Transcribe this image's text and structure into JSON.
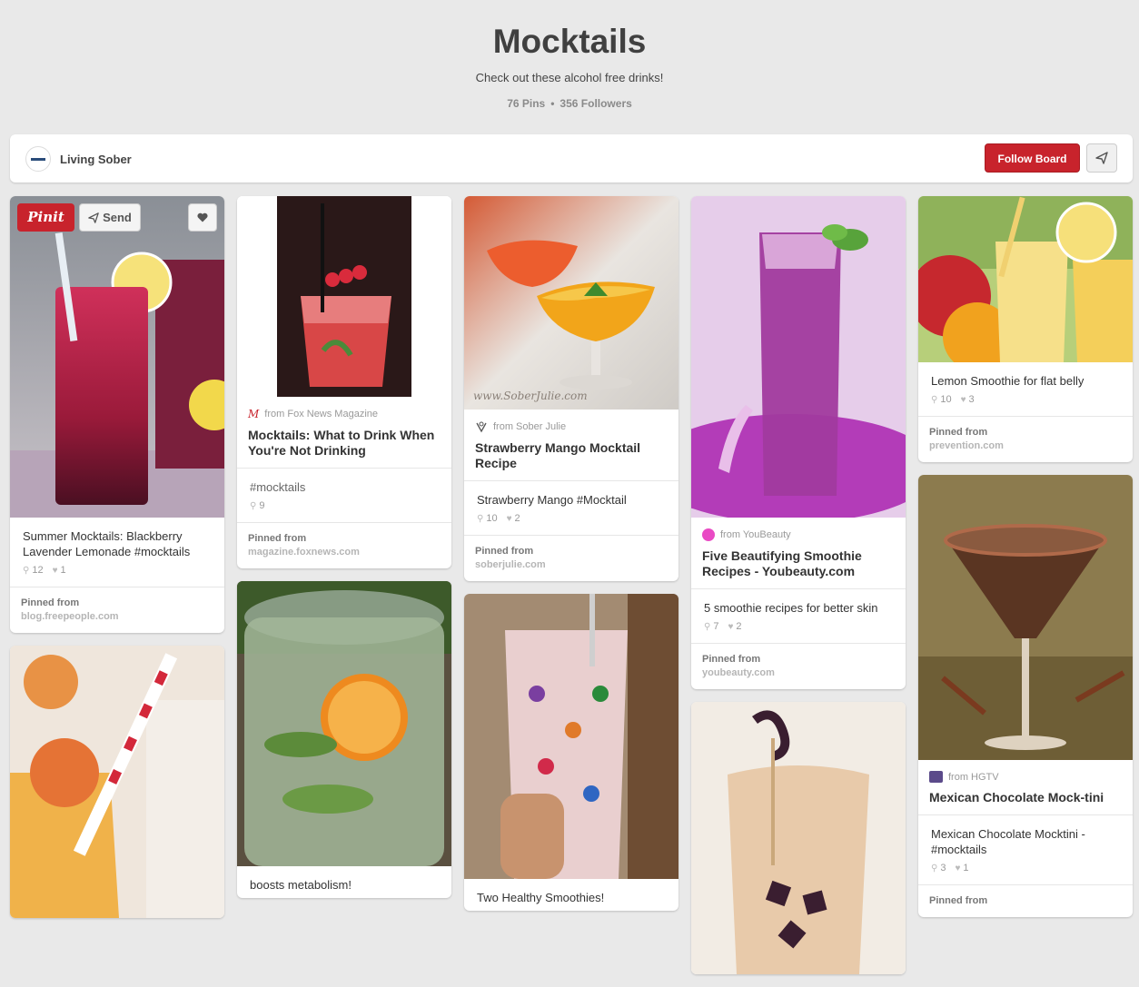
{
  "board": {
    "title": "Mocktails",
    "description": "Check out these alcohol free drinks!",
    "pins_count": "76 Pins",
    "followers_count": "356 Followers",
    "separator": "•"
  },
  "owner": {
    "name": "Living Sober"
  },
  "actions": {
    "follow_label": "Follow Board"
  },
  "hover_actions": {
    "pinit_label": "Pinit",
    "send_label": "Send"
  },
  "pins": {
    "p1": {
      "description": "Summer Mocktails: Blackberry Lavender Lemonade #mocktails",
      "repins": "12",
      "likes": "1",
      "pinned_label": "Pinned from",
      "pinned_domain": "blog.freepeople.com"
    },
    "p2": {
      "source": "from Fox News Magazine",
      "title": "Mocktails: What to Drink When You're Not Drinking",
      "description": "#mocktails",
      "repins": "9",
      "pinned_label": "Pinned from",
      "pinned_domain": "magazine.foxnews.com"
    },
    "p3": {
      "watermark": "www.SoberJulie.com",
      "source": "from Sober Julie",
      "title": "Strawberry Mango Mocktail Recipe",
      "description": "Strawberry Mango #Mocktail",
      "repins": "10",
      "likes": "2",
      "pinned_label": "Pinned from",
      "pinned_domain": "soberjulie.com"
    },
    "p4": {
      "source": "from YouBeauty",
      "title": "Five Beautifying Smoothie Recipes - Youbeauty.com",
      "description": "5 smoothie recipes for better skin",
      "repins": "7",
      "likes": "2",
      "pinned_label": "Pinned from",
      "pinned_domain": "youbeauty.com"
    },
    "p5": {
      "description": "Lemon Smoothie for flat belly",
      "repins": "10",
      "likes": "3",
      "pinned_label": "Pinned from",
      "pinned_domain": "prevention.com"
    },
    "p6": {
      "source": "from HGTV",
      "title": "Mexican Chocolate Mock-tini",
      "description": "Mexican Chocolate Mocktini - #mocktails",
      "repins": "3",
      "likes": "1",
      "pinned_label": "Pinned from"
    },
    "p7": {
      "description": "boosts metabolism!"
    },
    "p8": {
      "description": "Two Healthy Smoothies!"
    }
  },
  "colors": {
    "accent": "#c8232c",
    "background": "#e9e9e9"
  }
}
